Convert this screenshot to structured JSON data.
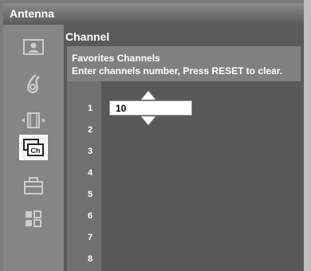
{
  "header": {
    "title": "Antenna"
  },
  "menu": {
    "items": [
      {
        "name": "picture-icon"
      },
      {
        "name": "sound-icon"
      },
      {
        "name": "screen-icon"
      },
      {
        "name": "channel-icon",
        "label": "Ch",
        "selected": true
      },
      {
        "name": "setup-icon"
      },
      {
        "name": "features-icon"
      }
    ]
  },
  "section": {
    "title": "Channel",
    "heading": "Favorites Channels",
    "instructions": "Enter channels number, Press RESET to clear."
  },
  "favorites": {
    "numbers": [
      "1",
      "2",
      "3",
      "4",
      "5",
      "6",
      "7",
      "8"
    ],
    "entry_value": "10"
  },
  "colors": {
    "background": "#5a5a5a",
    "selected_menu": "#f2f2f2",
    "text": "#ffffff"
  }
}
